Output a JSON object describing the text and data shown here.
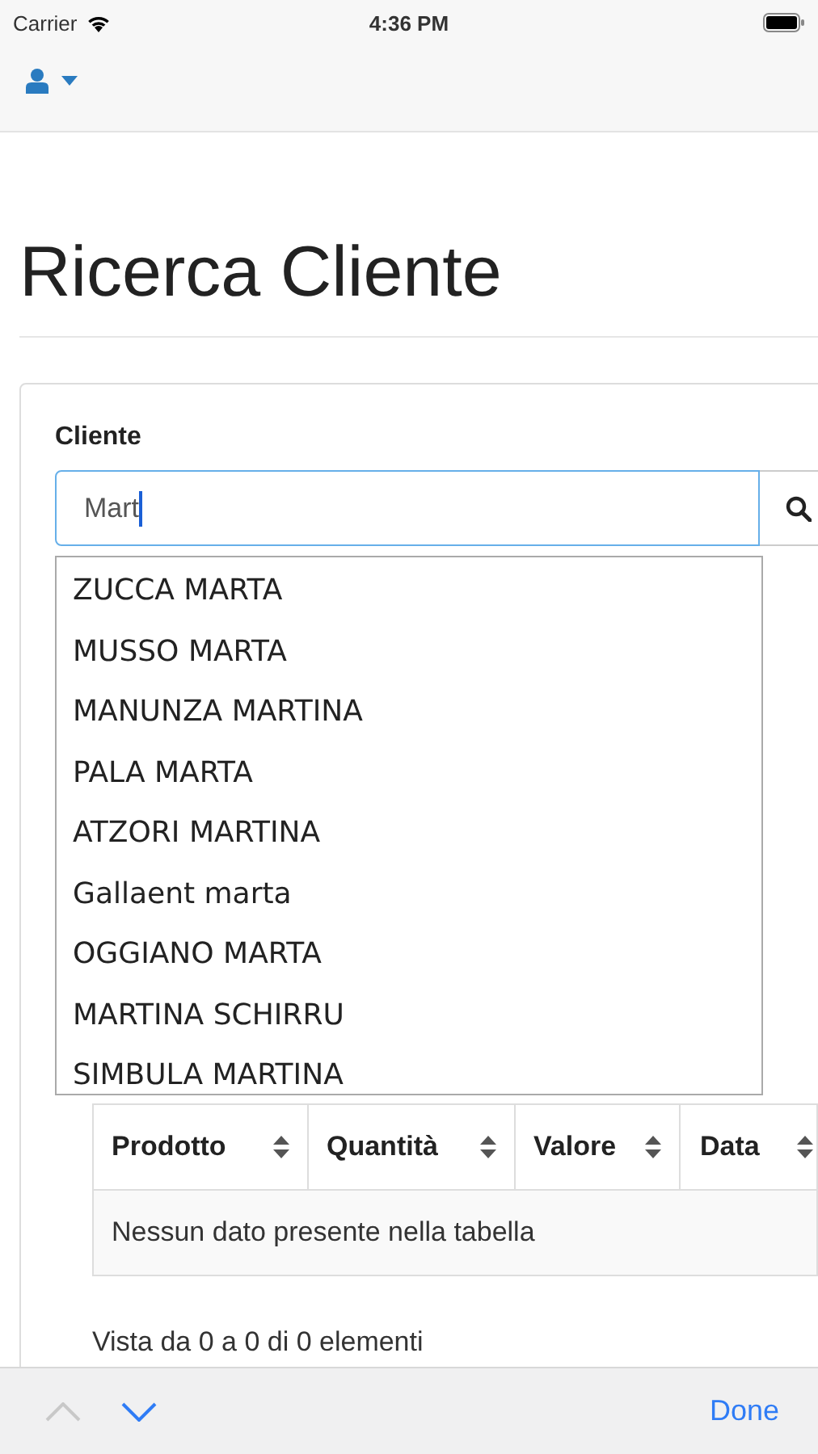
{
  "status_bar": {
    "carrier": "Carrier",
    "time": "4:36 PM"
  },
  "page_title": "Ricerca Cliente",
  "search": {
    "label": "Cliente",
    "value": "Mart"
  },
  "suggestions": [
    "ZUCCA MARTA",
    "MUSSO MARTA",
    "MANUNZA MARTINA",
    "PALA MARTA",
    "ATZORI MARTINA",
    "Gallaent marta",
    "OGGIANO MARTA",
    "MARTINA SCHIRRU",
    "SIMBULA MARTINA"
  ],
  "table": {
    "columns": [
      "Prodotto",
      "Quantità",
      "Valore",
      "Data"
    ],
    "empty_message": "Nessun dato presente nella tabella",
    "info": "Vista da 0 a 0 di 0 elementi"
  },
  "keyboard_bar": {
    "arrows": [
      {
        "kind": "previous",
        "disabled": true
      },
      {
        "kind": "next",
        "disabled": false
      }
    ],
    "done": "Done"
  }
}
